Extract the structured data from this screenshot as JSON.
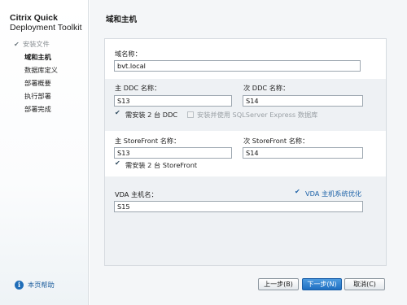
{
  "brand": {
    "line1": "Citrix Quick",
    "line2": "Deployment Toolkit"
  },
  "steps": [
    {
      "label": "安装文件",
      "state": "done"
    },
    {
      "label": "域和主机",
      "state": "active"
    },
    {
      "label": "数据库定义",
      "state": "pending"
    },
    {
      "label": "部署概要",
      "state": "pending"
    },
    {
      "label": "执行部署",
      "state": "pending"
    },
    {
      "label": "部署完成",
      "state": "pending"
    }
  ],
  "help": {
    "label": "本页帮助"
  },
  "page": {
    "title": "域和主机"
  },
  "form": {
    "domain": {
      "label": "域名称：",
      "value": "bvt.local"
    },
    "primary_ddc": {
      "label": "主 DDC 名称：",
      "value": "S13"
    },
    "secondary_ddc": {
      "label": "次 DDC 名称：",
      "value": "S14"
    },
    "need_two_ddc": {
      "label": "需安装 2 台 DDC",
      "checked": true
    },
    "install_sql": {
      "label": "安装并使用 SQLServer Express 数据库",
      "checked": false
    },
    "primary_sf": {
      "label": "主 StoreFront 名称：",
      "value": "S13"
    },
    "secondary_sf": {
      "label": "次 StoreFront 名称：",
      "value": "S14"
    },
    "need_two_sf": {
      "label": "需安装 2 台 StoreFront",
      "checked": true
    },
    "vda_host": {
      "label": "VDA 主机名：",
      "value": "S15"
    },
    "vda_optimize": {
      "label": "VDA 主机系统优化",
      "checked": true
    }
  },
  "buttons": {
    "prev": "上一步(B)",
    "next": "下一步(N)",
    "cancel": "取消(C)"
  }
}
